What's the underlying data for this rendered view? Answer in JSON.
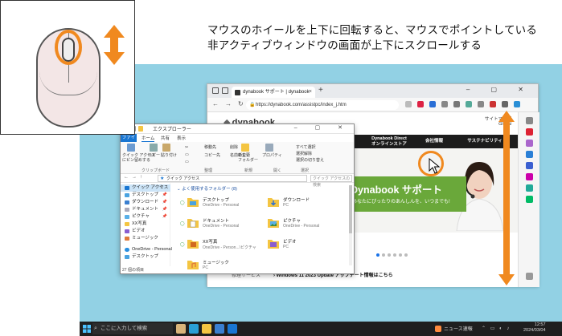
{
  "caption": {
    "line1": "マウスのホイールを上下に回転すると、マウスでポイントしている",
    "line2": "非アクティブウィンドウの画面が上下にスクロールする"
  },
  "colors": {
    "accent": "#f0891f",
    "desktop": "#92d1e4",
    "taskbar": "#1f1f1f",
    "hero_green": "#6aa83a"
  },
  "browser": {
    "tab_title": "dynabook サポート | dynabook",
    "url": "https://dynabook.com/assistpc/index_j.htm",
    "logo": "dynabook",
    "top_links": "サイトマップ",
    "global": "Global",
    "nav_items": [
      "Dynabook Direct\nオンラインストア",
      "会社情報",
      "サステナビリティ"
    ],
    "hero_title": "Dynabook サポート",
    "hero_sub": "あなたにぴったりのあんしんを、いつまでも!",
    "news": "Windows 11 2023 Update アップデート情報はこちら",
    "support_link": "修理サービス"
  },
  "explorer": {
    "title": "エクスプローラー",
    "tabs": [
      "ファイル",
      "ホーム",
      "共有",
      "表示"
    ],
    "ribbon": {
      "pin_label": "クイック アクセス\nにピン留めする",
      "copy": "コピー",
      "paste": "貼り付け",
      "move_to": "移動先",
      "delete": "削除",
      "copy_to": "コピー先",
      "rename": "名前の変更",
      "new_folder": "新しい\nフォルダー",
      "properties": "プロパティ",
      "select_all": "すべて選択",
      "select_none": "選択解除",
      "invert": "選択の切り替え",
      "groups": [
        "クリップボード",
        "整理",
        "新規",
        "開く",
        "選択"
      ]
    },
    "address": "クイック アクセス",
    "search_placeholder": "クイック アクセスの検索",
    "nav": [
      "クイック アクセス",
      "デスクトップ",
      "ダウンロード",
      "ドキュメント",
      "ピクチャ",
      "XX写真",
      "ビデオ",
      "ミュージック",
      "OneDrive - Personal",
      "デスクトップ"
    ],
    "section": "よく使用するフォルダー (8)",
    "tiles": [
      {
        "name": "デスクトップ",
        "sub": "OneDrive - Personal"
      },
      {
        "name": "ダウンロード",
        "sub": "PC"
      },
      {
        "name": "ドキュメント",
        "sub": "OneDrive - Personal"
      },
      {
        "name": "ピクチャ",
        "sub": "OneDrive - Personal"
      },
      {
        "name": "XX写真",
        "sub": "OneDrive - Person...\\ピクチャ"
      },
      {
        "name": "ビデオ",
        "sub": "PC"
      },
      {
        "name": "ミュージック",
        "sub": "PC"
      }
    ],
    "status": "27 個の項目"
  },
  "taskbar": {
    "search_placeholder": "ここに入力して検索",
    "news": "ニュース速報",
    "time": "12:57",
    "date": "2024/03/04"
  }
}
